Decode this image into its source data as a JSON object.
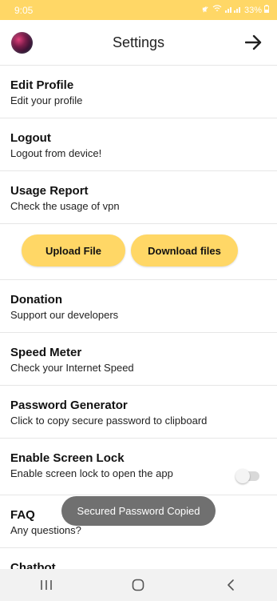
{
  "status_bar": {
    "time": "9:05",
    "battery": "33%"
  },
  "header": {
    "title": "Settings"
  },
  "menu": {
    "edit_profile": {
      "title": "Edit Profile",
      "subtitle": "Edit your profile"
    },
    "logout": {
      "title": "Logout",
      "subtitle": "Logout from device!"
    },
    "usage_report": {
      "title": "Usage Report",
      "subtitle": "Check the usage of vpn"
    },
    "buttons": {
      "upload": "Upload File",
      "download": "Download files"
    },
    "donation": {
      "title": "Donation",
      "subtitle": "Support our developers"
    },
    "speed_meter": {
      "title": "Speed Meter",
      "subtitle": "Check your Internet Speed"
    },
    "password_generator": {
      "title": "Password Generator",
      "subtitle": "Click to copy secure password to clipboard"
    },
    "screen_lock": {
      "title": "Enable Screen Lock",
      "subtitle": "Enable screen lock to open the app",
      "enabled": false
    },
    "faq": {
      "title": "FAQ",
      "subtitle": "Any questions?"
    },
    "chatbot": {
      "title": "Chatbot"
    }
  },
  "toast": "Secured Password Copied",
  "colors": {
    "accent": "#ffd766",
    "divider": "#e6e6e6",
    "toast_bg": "#646464"
  },
  "icons": {
    "header_left": "avatar",
    "header_right": "arrow-right-icon",
    "nav": [
      "recent-apps-icon",
      "home-icon",
      "back-icon"
    ]
  }
}
